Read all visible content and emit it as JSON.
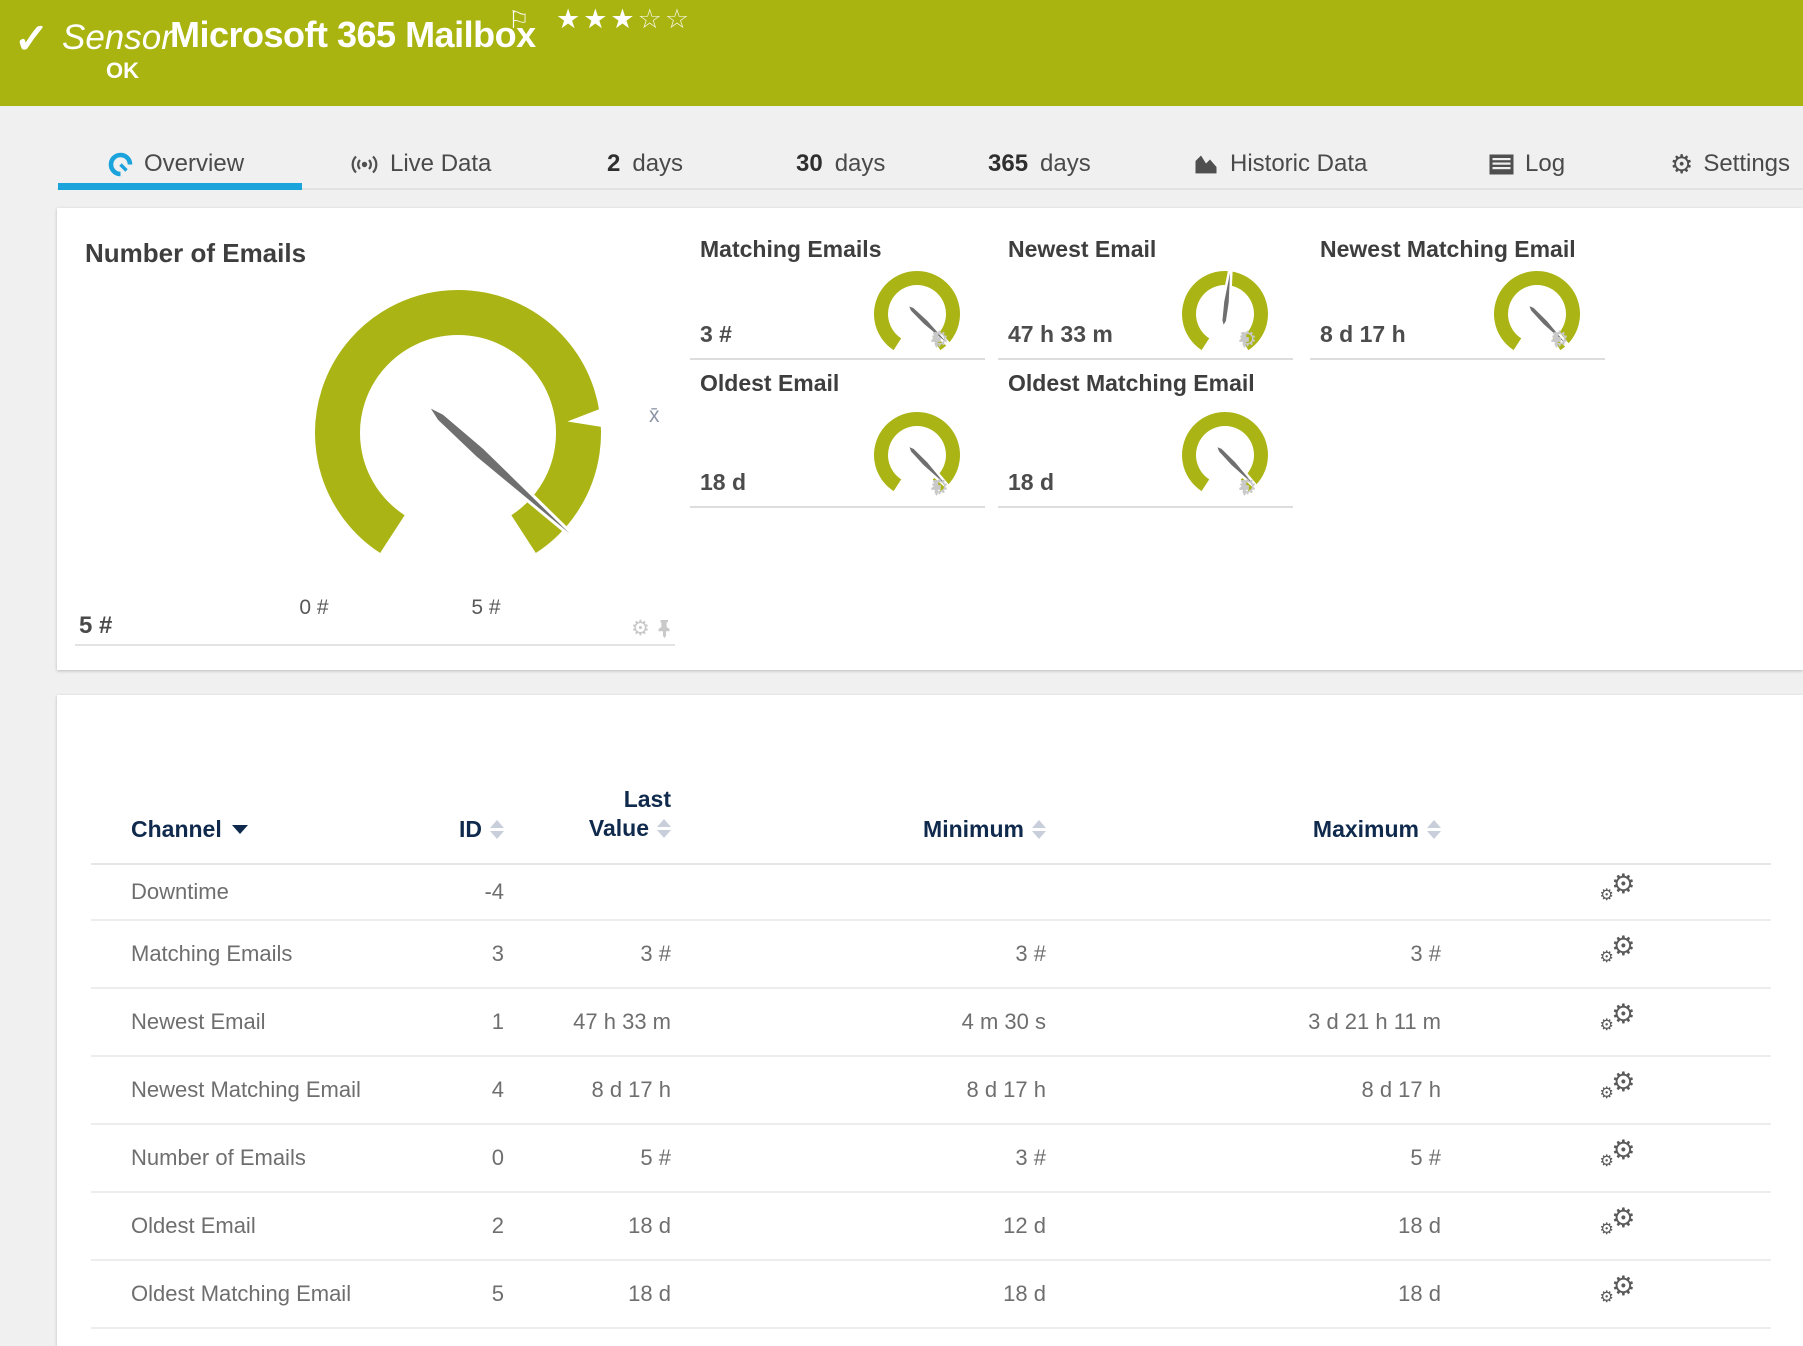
{
  "icons": {
    "gear_glyph": "⚙"
  },
  "header": {
    "entity_label": "Sensor",
    "title": "Microsoft 365 Mailbox",
    "status": "OK",
    "icons": {
      "check": "✓",
      "flag": "⚐"
    },
    "stars": {
      "filled": "★★★",
      "empty": "☆☆"
    },
    "color": "#a9b410"
  },
  "tabs": [
    {
      "label": "Overview",
      "icon": "gauge-icon",
      "active": true
    },
    {
      "label": "Live Data",
      "icon": "broadcast-icon"
    },
    {
      "prefix": "2",
      "label": "days"
    },
    {
      "prefix": "30",
      "label": "days"
    },
    {
      "prefix": "365",
      "label": "days"
    },
    {
      "label": "Historic Data",
      "icon": "area-chart-icon"
    },
    {
      "label": "Log",
      "icon": "log-icon"
    },
    {
      "label": "Settings",
      "icon": "gear-icon"
    }
  ],
  "gauges": {
    "accent_green": "#aab414",
    "needle_gray": "#6f6f6f",
    "primary": {
      "title": "Number of Emails",
      "value": "5 #",
      "scale_min": "0 #",
      "scale_max": "5 #",
      "avg_marker": "x̄"
    },
    "minis": [
      {
        "title": "Matching Emails",
        "value": "3 #"
      },
      {
        "title": "Newest Email",
        "value": "47 h 33 m"
      },
      {
        "title": "Newest Matching Email",
        "value": "8 d 17 h"
      },
      {
        "title": "Oldest Email",
        "value": "18 d"
      },
      {
        "title": "Oldest Matching Email",
        "value": "18 d"
      }
    ]
  },
  "table": {
    "header": {
      "channel": "Channel",
      "id": "ID",
      "last_line1": "Last",
      "last_line2": "Value",
      "minimum": "Minimum",
      "maximum": "Maximum"
    },
    "rows": [
      {
        "channel": "Downtime",
        "id": "-4",
        "last": "",
        "min": "",
        "max": ""
      },
      {
        "channel": "Matching Emails",
        "id": "3",
        "last": "3 #",
        "min": "3 #",
        "max": "3 #"
      },
      {
        "channel": "Newest Email",
        "id": "1",
        "last": "47 h 33 m",
        "min": "4 m 30 s",
        "max": "3 d 21 h 11 m"
      },
      {
        "channel": "Newest Matching Email",
        "id": "4",
        "last": "8 d 17 h",
        "min": "8 d 17 h",
        "max": "8 d 17 h"
      },
      {
        "channel": "Number of Emails",
        "id": "0",
        "last": "5 #",
        "min": "3 #",
        "max": "5 #"
      },
      {
        "channel": "Oldest Email",
        "id": "2",
        "last": "18 d",
        "min": "12 d",
        "max": "18 d"
      },
      {
        "channel": "Oldest Matching Email",
        "id": "5",
        "last": "18 d",
        "min": "18 d",
        "max": "18 d"
      }
    ]
  }
}
